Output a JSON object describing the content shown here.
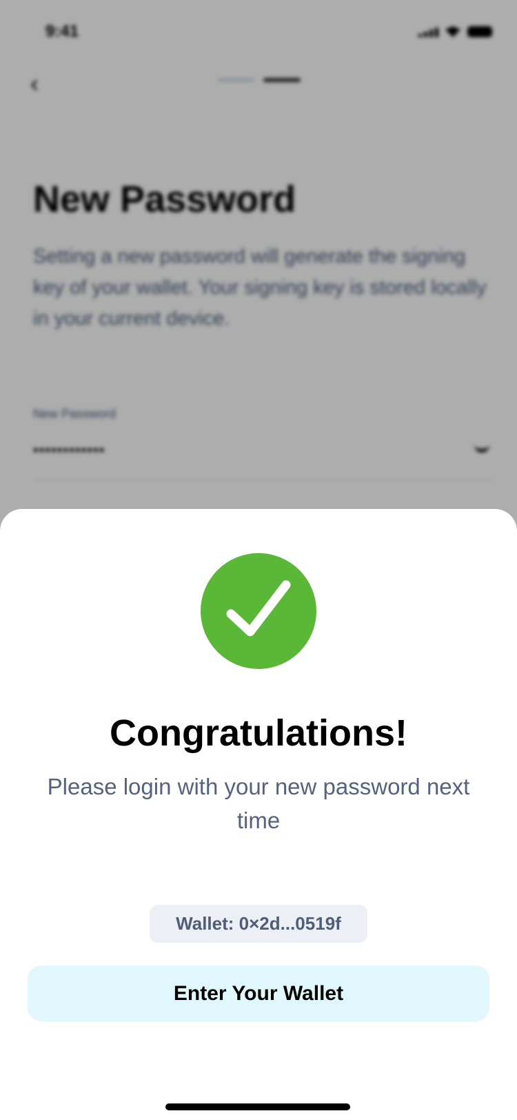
{
  "status_bar": {
    "time": "9:41"
  },
  "background": {
    "title": "New Password",
    "description": "Setting a new password will generate the signing key of your wallet. Your signing key is stored locally in your current device.",
    "field_label": "New Password",
    "field_value": "••••••••••••",
    "progress_step": 2,
    "progress_total": 2,
    "colors": {
      "step_inactive": "#b6c6d6",
      "step_active": "#333333"
    }
  },
  "sheet": {
    "title": "Congratulations!",
    "subtitle": "Please login with your new password next time",
    "wallet": "Wallet: 0×2d...0519f",
    "button": "Enter Your Wallet",
    "colors": {
      "success": "#5ab738",
      "button_bg": "#e0f8fd"
    }
  }
}
